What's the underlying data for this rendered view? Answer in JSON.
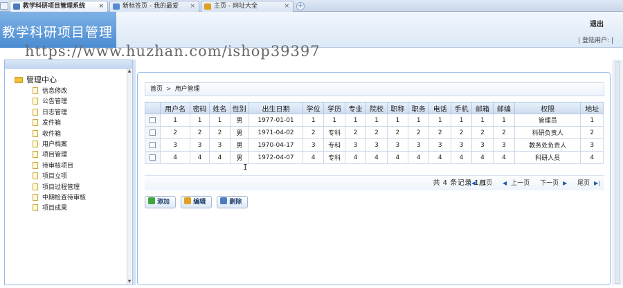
{
  "browser": {
    "tabs": [
      {
        "label": "教学科研项目管理系统",
        "active": true,
        "icon_color": "#4a7cc0",
        "close": "×"
      },
      {
        "label": "新标签页 - 我的最爱",
        "active": false,
        "icon_color": "#5a8bd0",
        "close": "×"
      },
      {
        "label": "主页 - 网址大全",
        "active": false,
        "icon_color": "#e0a020",
        "close": "×"
      }
    ],
    "new_tab": "+"
  },
  "header": {
    "app_title": "教学科研项目管理",
    "exit_label": "退出",
    "user_info": "| 登陆用户: |"
  },
  "watermark": "https://www.huzhan.com/ishop39397",
  "sidebar": {
    "root_label": "管理中心",
    "items": [
      "信息修改",
      "公告管理",
      "日志管理",
      "发件箱",
      "收件箱",
      "用户档案",
      "项目管理",
      "待审核项目",
      "项目立项",
      "项目过程管理",
      "中期检查待审核",
      "项目成果"
    ]
  },
  "breadcrumb": {
    "home": "首页",
    "separator": ">",
    "current": "用户管理"
  },
  "table": {
    "columns": [
      "",
      "用户名",
      "密码",
      "姓名",
      "性别",
      "出生日期",
      "学位",
      "学历",
      "专业",
      "院校",
      "职称",
      "职务",
      "电话",
      "手机",
      "邮箱",
      "邮编",
      "权限",
      "地址"
    ],
    "rows": [
      [
        "1",
        "1",
        "1",
        "男",
        "1977-01-01",
        "1",
        "1",
        "1",
        "1",
        "1",
        "1",
        "1",
        "1",
        "1",
        "1",
        "管理员",
        "1"
      ],
      [
        "2",
        "2",
        "2",
        "男",
        "1971-04-02",
        "2",
        "专科",
        "2",
        "2",
        "2",
        "2",
        "2",
        "2",
        "2",
        "2",
        "科研负责人",
        "2"
      ],
      [
        "3",
        "3",
        "3",
        "男",
        "1970-04-17",
        "3",
        "专科",
        "3",
        "3",
        "3",
        "3",
        "3",
        "3",
        "3",
        "3",
        "教务处负责人",
        "3"
      ],
      [
        "4",
        "4",
        "4",
        "男",
        "1972-04-07",
        "4",
        "专科",
        "4",
        "4",
        "4",
        "4",
        "4",
        "4",
        "4",
        "4",
        "科研人员",
        "4"
      ]
    ]
  },
  "pager": {
    "summary": "共 4 条记录 1/1",
    "first": "首页",
    "prev": "上一页",
    "next": "下一页",
    "last": "尾页"
  },
  "actions": {
    "add": "添加",
    "edit": "编辑",
    "delete": "删除"
  },
  "colors": {
    "accent": "#4b8bd1",
    "border": "#99bbe8"
  }
}
